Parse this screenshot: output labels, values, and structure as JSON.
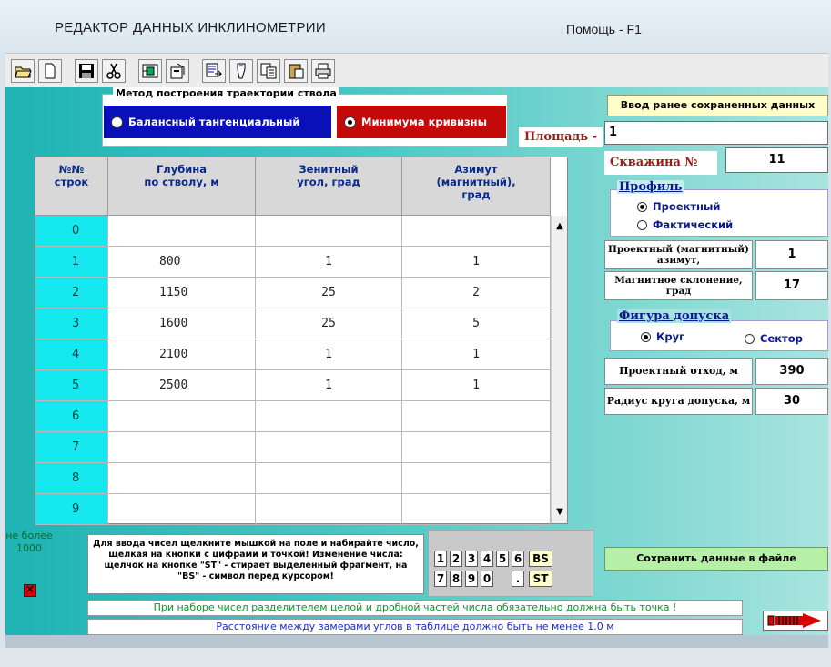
{
  "window": {
    "title": "РЕДАКТОР   ДАННЫХ   ИНКЛИНОМЕТРИИ",
    "help": "Помощь - F1"
  },
  "toolbar": {
    "buttons": [
      {
        "name": "open-folder-icon"
      },
      {
        "name": "new-file-icon"
      },
      {
        "name": "save-icon"
      },
      {
        "name": "cut-icon"
      },
      {
        "name": "import-icon"
      },
      {
        "name": "properties-icon"
      },
      {
        "name": "export-icon"
      },
      {
        "name": "paste-icon"
      },
      {
        "name": "copy-icon"
      },
      {
        "name": "clipboard-icon"
      },
      {
        "name": "print-icon"
      }
    ]
  },
  "method": {
    "title": "Метод построения траектории ствола",
    "options": [
      {
        "label": "Балансный тангенциальный",
        "selected": false
      },
      {
        "label": "Минимума кривизны",
        "selected": true
      }
    ]
  },
  "area": {
    "label": "Площадь -",
    "value": "1"
  },
  "load_button": "Ввод ранее сохраненных данных",
  "table": {
    "headers": [
      "№№\nстрок",
      "Глубина\nпо стволу, м",
      "Зенитный\nугол, град",
      "Азимут\n(магнитный),\nград"
    ],
    "rows": [
      [
        "0",
        "",
        "",
        ""
      ],
      [
        "1",
        "800",
        "1",
        "1"
      ],
      [
        "2",
        "1150",
        "25",
        "2"
      ],
      [
        "3",
        "1600",
        "25",
        "5"
      ],
      [
        "4",
        "2100",
        "1",
        "1"
      ],
      [
        "5",
        "2500",
        "1",
        "1"
      ],
      [
        "6",
        "",
        "",
        ""
      ],
      [
        "7",
        "",
        "",
        ""
      ],
      [
        "8",
        "",
        "",
        ""
      ],
      [
        "9",
        "",
        "",
        ""
      ]
    ],
    "scroll_up": "▲",
    "scroll_down": "▼"
  },
  "well": {
    "label": "Скважина №",
    "value": "11"
  },
  "profile": {
    "title": "Профиль",
    "options": [
      {
        "label": "Проектный",
        "selected": true
      },
      {
        "label": "Фактический",
        "selected": false
      }
    ]
  },
  "params": [
    {
      "label": "Проектный (магнитный) азимут,",
      "value": "1"
    },
    {
      "label": "Магнитное склонение, град",
      "value": "17"
    }
  ],
  "figure": {
    "title": "Фигура допуска",
    "options": [
      {
        "label": "Круг",
        "selected": true
      },
      {
        "label": "Сектор",
        "selected": false
      }
    ]
  },
  "distances": [
    {
      "label": "Проектный отход, м",
      "value": "390"
    },
    {
      "label": "Радиус круга допуска, м",
      "value": "30"
    }
  ],
  "save_button": "Сохранить данные в файле",
  "limit": "не более 1000",
  "instructions": "Для ввода чисел щелкните мышкой на поле и набирайте число, щелкая на кнопки с цифрами и точкой! Изменение числа: щелчок на кнопке \"ST\" - стирает выделенный фрагмент, на \"BS\" - символ перед курсором!",
  "keypad": {
    "row1": [
      "1",
      "2",
      "3",
      "4",
      "5",
      "6"
    ],
    "row2": [
      "7",
      "8",
      "9",
      "0",
      "",
      "."
    ],
    "bs": "BS",
    "st": "ST"
  },
  "notes": {
    "separator": "При наборе чисел разделителем целой и дробной частей числа обязательно должна быть точка !",
    "distance": "Расстояние между замерами углов в таблице должно быть не менее 1.0 м"
  },
  "colors": {
    "accent_teal": "#1fb3b4",
    "row_number": "#16e8f0",
    "method_blue": "#0a10b7",
    "method_red": "#c40909",
    "label_red": "#9a1c1c",
    "title_blue": "#0a1a8a"
  }
}
